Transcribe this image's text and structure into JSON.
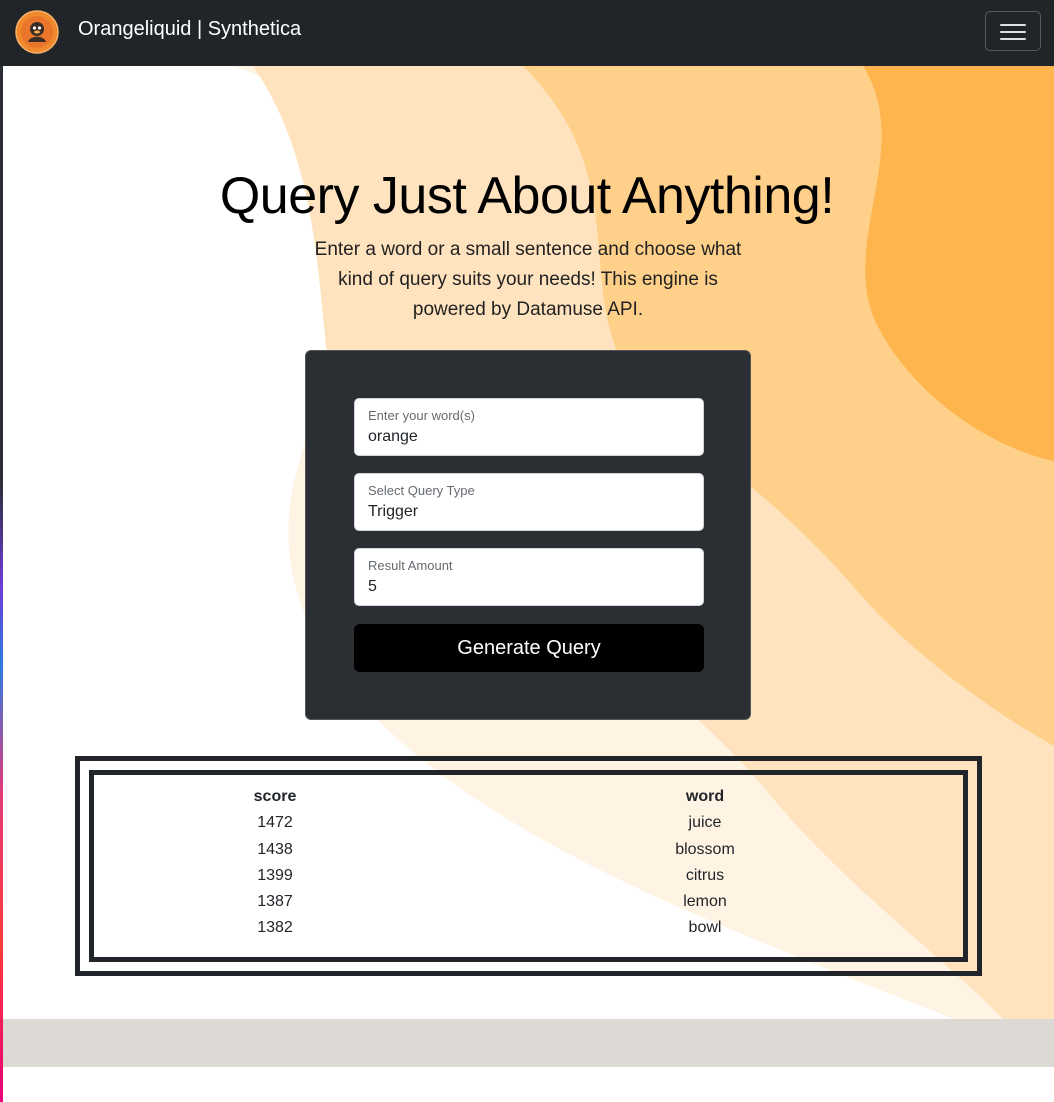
{
  "navbar": {
    "brand": "Orangeliquid | Synthetica",
    "logo_icon": "duck-mascot-icon",
    "toggler_icon": "hamburger-menu-icon"
  },
  "hero": {
    "title": "Query Just About Anything!",
    "subtitle": "Enter a word or a small sentence and choose what kind of query suits your needs! This engine is powered by Datamuse API."
  },
  "form": {
    "word_label": "Enter your word(s)",
    "word_value": "orange",
    "type_label": "Select Query Type",
    "type_value": "Trigger",
    "amount_label": "Result Amount",
    "amount_value": "5",
    "submit_label": "Generate Query"
  },
  "results": {
    "headers": [
      "score",
      "word"
    ],
    "rows": [
      [
        "1472",
        "juice"
      ],
      [
        "1438",
        "blossom"
      ],
      [
        "1399",
        "citrus"
      ],
      [
        "1387",
        "lemon"
      ],
      [
        "1382",
        "bowl"
      ]
    ]
  },
  "colors": {
    "navbar_bg": "#212529",
    "card_bg": "#2b2e32",
    "orange_light": "#ffe8c9",
    "orange_mid": "#ffd08a",
    "orange_dark": "#ffb54d"
  }
}
